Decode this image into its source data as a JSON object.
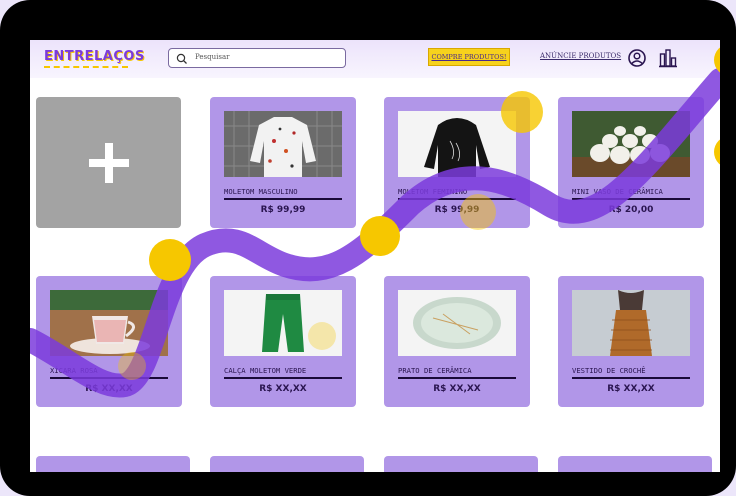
{
  "header": {
    "logo": "ENTRELAÇOS",
    "search_placeholder": "Pesquisar",
    "buy_label": "COMPRE PRODUTOS!",
    "sell_label": "ANÚNCIE PRODUTOS",
    "icons": [
      "search-icon",
      "user-icon",
      "bar-chart-icon"
    ]
  },
  "add_card": {
    "icon": "plus-icon"
  },
  "products": [
    {
      "name": "MOLETOM MASCULINO",
      "price": "R$ 99,99"
    },
    {
      "name": "MOLETOM FEMININO",
      "price": "R$ 99,99"
    },
    {
      "name": "MINI VASO DE CERÂMICA",
      "price": "R$ 20,00"
    },
    {
      "name": "XÍCARA ROSA",
      "price": "R$ XX,XX"
    },
    {
      "name": "CALÇA MOLETOM VERDE",
      "price": "R$ XX,XX"
    },
    {
      "name": "PRATO DE CERÂMICA",
      "price": "R$ XX,XX"
    },
    {
      "name": "VESTIDO DE CROCHÊ",
      "price": "R$ XX,XX"
    }
  ],
  "colors": {
    "accent": "#7b3bdc",
    "card": "#b196e8",
    "yellow": "#f7d21c",
    "add_card": "#a3a3a3",
    "frame": "#000000"
  }
}
